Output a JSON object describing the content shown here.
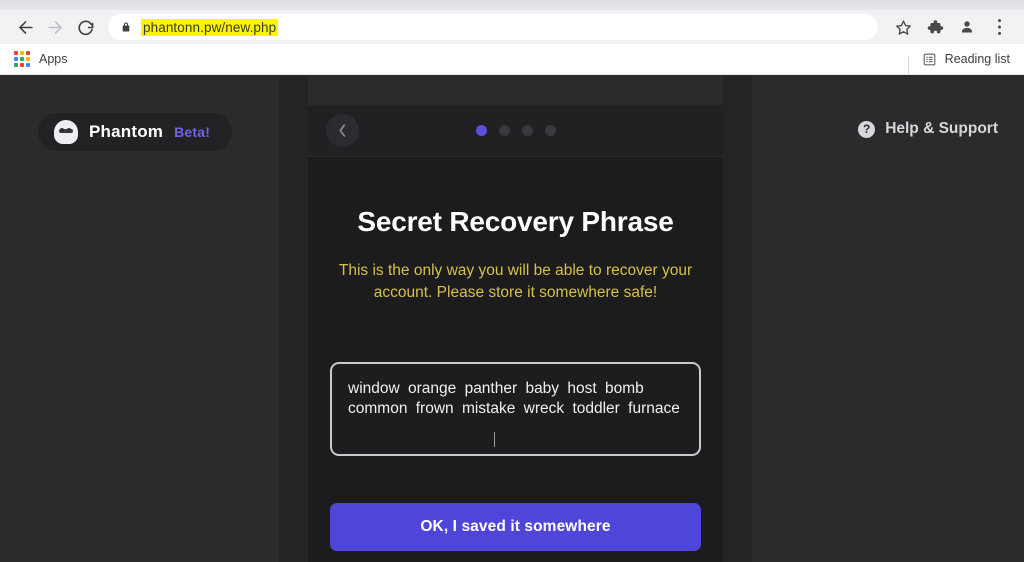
{
  "browser": {
    "nav": {
      "back_icon": "arrow-left-icon",
      "forward_icon": "arrow-right-icon",
      "reload_icon": "reload-icon"
    },
    "omnibox": {
      "lock_icon": "lock-icon",
      "url": "phantonn.pw/new.php",
      "placeholder": "Search Google or type a URL",
      "highlight_color": "#fdf500"
    },
    "toolbar_icons": [
      {
        "name": "bookmark-star-icon",
        "glyph": "star"
      },
      {
        "name": "extensions-puzzle-icon",
        "glyph": "puzzle"
      },
      {
        "name": "profile-avatar-icon",
        "glyph": "person"
      },
      {
        "name": "browser-menu-icon",
        "glyph": "three-dots"
      }
    ],
    "bookmarks": {
      "apps_label": "Apps",
      "apps_icon": "apps-grid-icon",
      "apps_dot_colors": [
        "#ea4335",
        "#fbbc05",
        "#ea4335",
        "#4285f4",
        "#34a853",
        "#fbbc05",
        "#34a853",
        "#ea4335",
        "#4285f4"
      ],
      "reading_list_label": "Reading list",
      "reading_list_icon": "reading-list-icon"
    }
  },
  "page": {
    "background_color": "#2b2b2e",
    "brand": {
      "logo_icon": "phantom-ghost-icon",
      "name": "Phantom",
      "beta_label": "Beta!",
      "beta_color": "#6f62e8"
    },
    "help": {
      "icon": "help-question-icon",
      "icon_glyph": "?",
      "label": "Help & Support"
    },
    "modal": {
      "back_button_icon": "chevron-left-icon",
      "back_button_glyph": "‹",
      "steps": {
        "total": 4,
        "current": 1,
        "active_color": "#5b4fe0",
        "inactive_color": "#3a3a3e"
      },
      "title": "Secret Recovery Phrase",
      "warning": "This is the only way you will be able to recover your account. Please store it somewhere safe!",
      "warning_color": "#d4c04a",
      "seed_phrase": {
        "words": [
          "window",
          "orange",
          "panther",
          "baby",
          "host",
          "bomb",
          "common",
          "frown",
          "mistake",
          "wreck",
          "toddler",
          "furnace"
        ],
        "text": "window orange panther baby host bomb common frown mistake wreck toddler furnace"
      },
      "cta_label": "OK, I saved it somewhere",
      "cta_color": "#4f46d9"
    }
  }
}
